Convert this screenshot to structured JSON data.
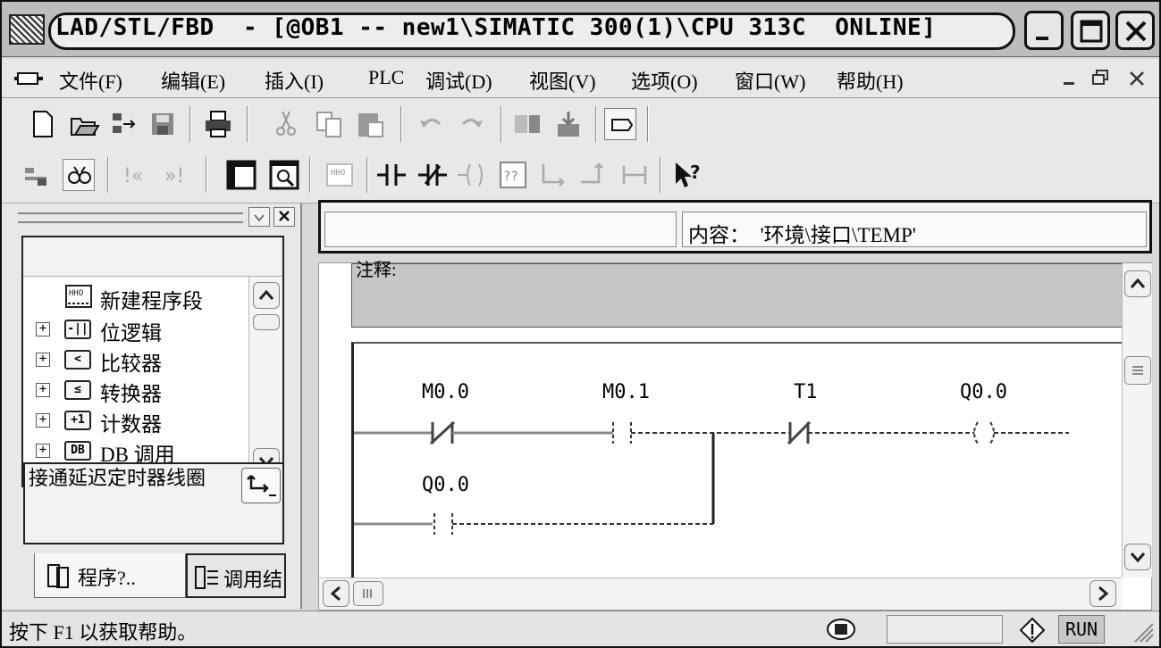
{
  "titlebar": {
    "title": "LAD/STL/FBD  - [@OB1 -- new1\\SIMATIC 300(1)\\CPU 313C  ONLINE]"
  },
  "menubar": {
    "items": [
      {
        "label": "文件(F)"
      },
      {
        "label": "编辑(E)"
      },
      {
        "label": "插入(I)"
      },
      {
        "label": "PLC"
      },
      {
        "label": "调试(D)"
      },
      {
        "label": "视图(V)"
      },
      {
        "label": "选项(O)"
      },
      {
        "label": "窗口(W)"
      },
      {
        "label": "帮助(H)"
      }
    ]
  },
  "toolbar": {
    "row1_icons": [
      "new-icon",
      "open-icon",
      "network-icon",
      "save-icon",
      "print-icon",
      "cut-icon",
      "copy-icon",
      "paste-icon",
      "undo-icon",
      "redo-icon",
      "download-icon",
      "upload-icon",
      "display-icon"
    ],
    "row2_icons": [
      "accessible-nodes-icon",
      "monitor-icon",
      "back-icon",
      "forward-icon",
      "overview-icon",
      "details-icon",
      "new-network-icon",
      "no-contact-icon",
      "nc-contact-icon",
      "coil-icon",
      "empty-box-icon",
      "branch-open-icon",
      "branch-close-icon",
      "connection-icon",
      "help-icon"
    ]
  },
  "left_pane": {
    "tree": [
      {
        "icon": "new-network-icon",
        "label": "新建程序段",
        "expander": ""
      },
      {
        "icon": "bit-logic-folder-icon",
        "folder_text": "-||",
        "label": "位逻辑",
        "expander": "+"
      },
      {
        "icon": "comparator-folder-icon",
        "folder_text": "<",
        "label": "比较器",
        "expander": "+"
      },
      {
        "icon": "converter-folder-icon",
        "folder_text": "≤",
        "label": "转换器",
        "expander": "+"
      },
      {
        "icon": "counter-folder-icon",
        "folder_text": "+1",
        "label": "计数器",
        "expander": "+"
      },
      {
        "icon": "db-call-folder-icon",
        "folder_text": "DB",
        "label": "DB 调用",
        "expander": "+"
      }
    ],
    "info_text": "接通延迟定时器线圈",
    "tabs": [
      {
        "label": "程序?..",
        "active": true
      },
      {
        "label": "调用结",
        "active": false
      }
    ]
  },
  "content_bar": {
    "left_value": "",
    "right_label": "内容：  '环境\\接口\\TEMP'"
  },
  "editor": {
    "comment_label": "注释:",
    "network": {
      "rung1": [
        {
          "operand": "M0.0",
          "element": "normally-closed-contact"
        },
        {
          "operand": "M0.1",
          "element": "normally-open-contact"
        },
        {
          "operand": "T1",
          "element": "normally-closed-contact"
        },
        {
          "operand": "Q0.0",
          "element": "coil"
        }
      ],
      "rung2": [
        {
          "operand": "Q0.0",
          "element": "normally-open-contact"
        }
      ]
    }
  },
  "statusbar": {
    "help_text": "按下 F1 以获取帮助。",
    "mode": "RUN"
  }
}
